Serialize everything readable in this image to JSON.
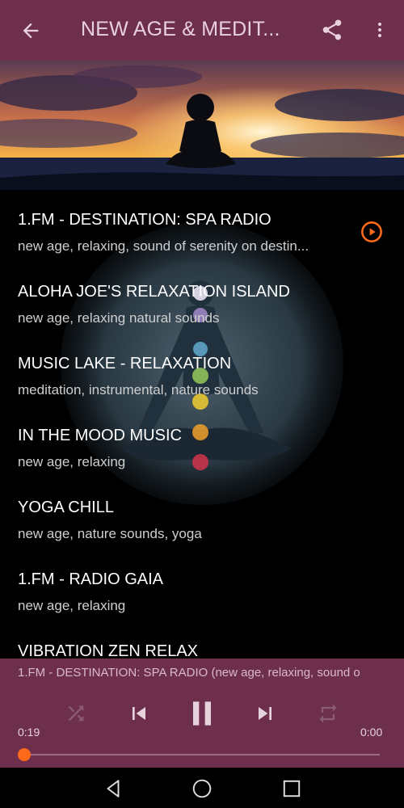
{
  "header": {
    "title": "NEW AGE & MEDIT...",
    "back_icon": "arrow-left-icon",
    "share_icon": "share-icon",
    "more_icon": "more-vert-icon"
  },
  "stations": [
    {
      "name": "1.FM - DESTINATION: SPA RADIO",
      "tags": "new age, relaxing, sound of serenity on destin...",
      "playing": true
    },
    {
      "name": "ALOHA JOE'S RELAXATION ISLAND",
      "tags": "new age, relaxing natural sounds"
    },
    {
      "name": "MUSIC LAKE - RELAXATION",
      "tags": "meditation, instrumental, nature sounds"
    },
    {
      "name": "IN THE MOOD MUSIC",
      "tags": "new age, relaxing"
    },
    {
      "name": "YOGA CHILL",
      "tags": "new age, nature sounds, yoga"
    },
    {
      "name": "1.FM - RADIO GAIA",
      "tags": "new age, relaxing"
    },
    {
      "name": "VIBRATION ZEN RELAX",
      "tags": ""
    }
  ],
  "player": {
    "now_playing": "1.FM - DESTINATION: SPA RADIO (new age, relaxing, sound o",
    "elapsed": "0:19",
    "duration": "0:00",
    "progress": 0.0,
    "accent": "#ff6a1a",
    "bar_color": "#6e2f4d"
  }
}
